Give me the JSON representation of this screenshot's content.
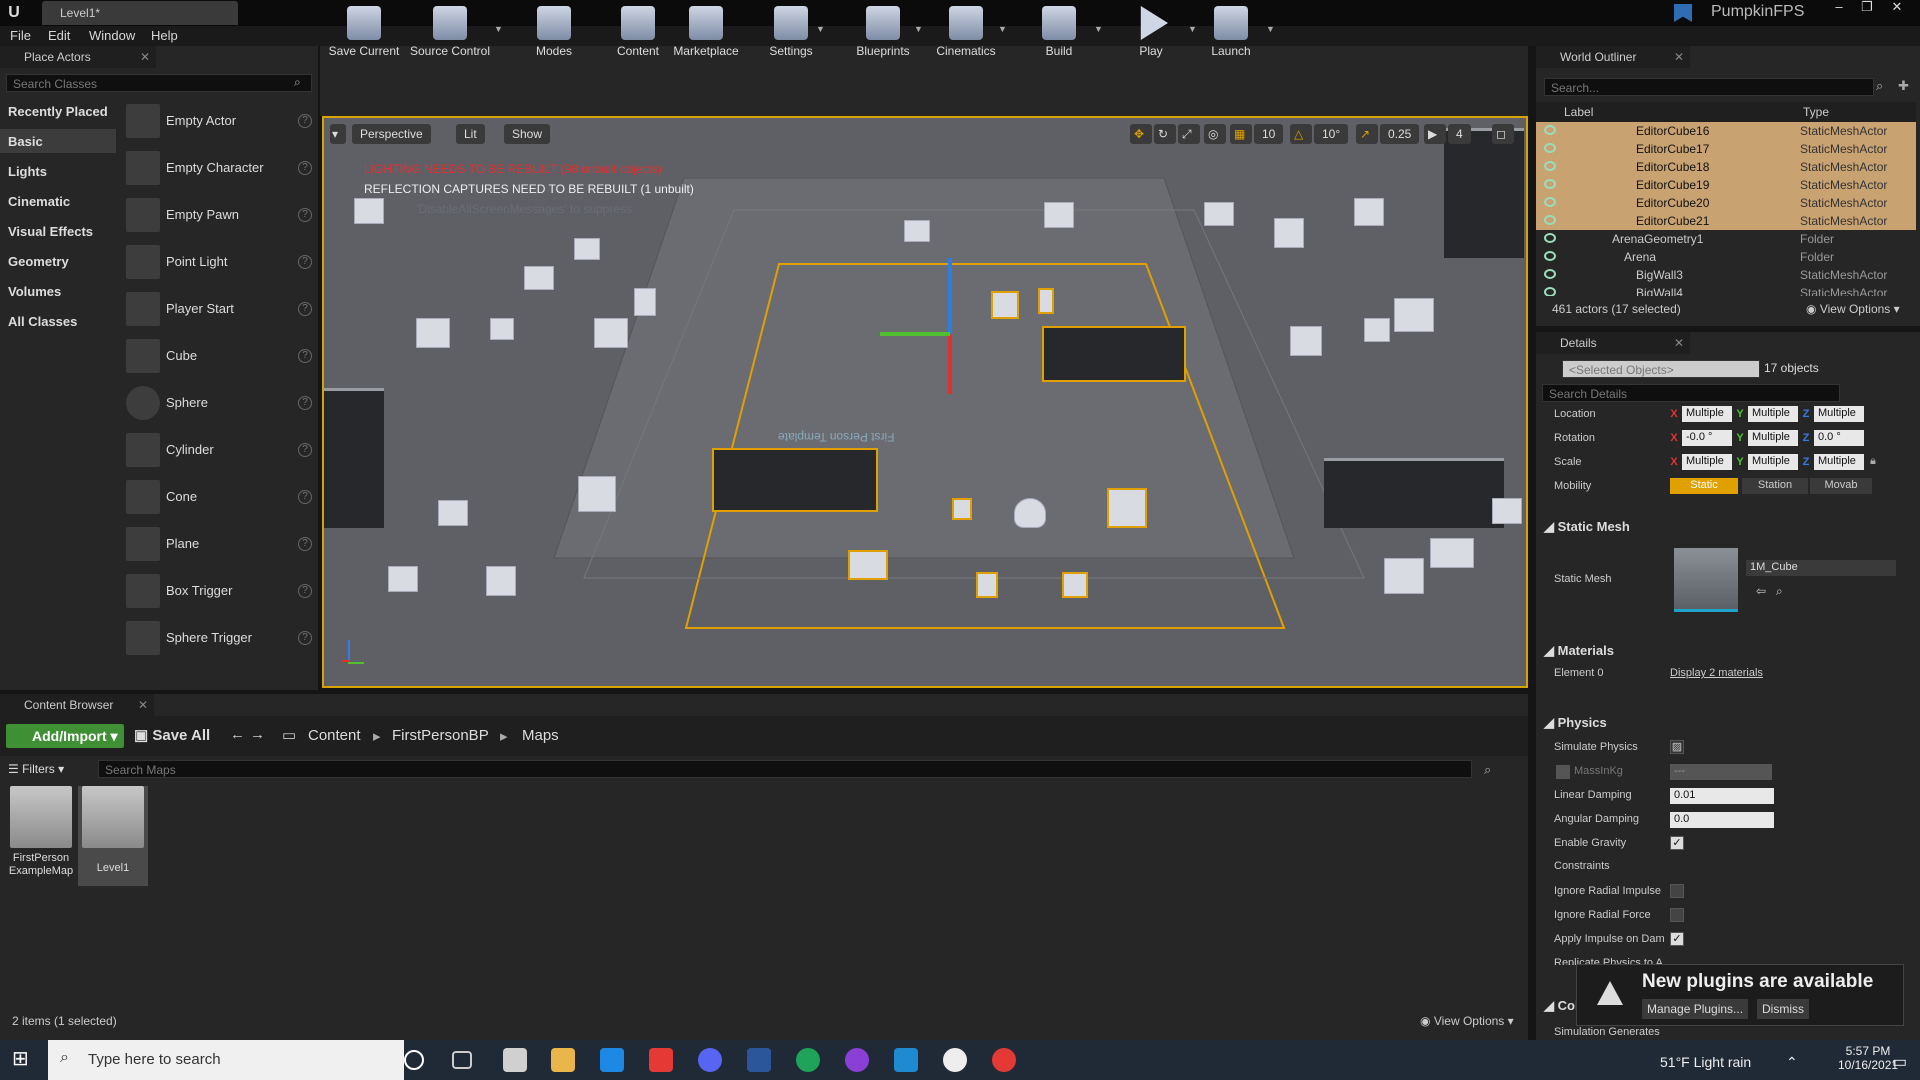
{
  "window": {
    "tab_title": "Level1*",
    "project": "PumpkinFPS",
    "controls": [
      "–",
      "❐",
      "✕"
    ]
  },
  "menu": [
    "File",
    "Edit",
    "Window",
    "Help"
  ],
  "place_actors": {
    "title": "Place Actors",
    "search_placeholder": "Search Classes",
    "categories": [
      "Recently Placed",
      "Basic",
      "Lights",
      "Cinematic",
      "Visual Effects",
      "Geometry",
      "Volumes",
      "All Classes"
    ],
    "selected_category": "Basic",
    "actors": [
      "Empty Actor",
      "Empty Character",
      "Empty Pawn",
      "Point Light",
      "Player Start",
      "Cube",
      "Sphere",
      "Cylinder",
      "Cone",
      "Plane",
      "Box Trigger",
      "Sphere Trigger"
    ]
  },
  "toolbar": [
    "Save Current",
    "Source Control",
    "Modes",
    "Content",
    "Marketplace",
    "Settings",
    "Blueprints",
    "Cinematics",
    "Build",
    "Play",
    "Launch"
  ],
  "viewport": {
    "view_mode": "Perspective",
    "lighting": "Lit",
    "show": "Show",
    "warning_lighting": "LIGHTING NEEDS TO BE REBUILT (98 unbuilt objects)",
    "warning_reflection": "REFLECTION CAPTURES NEED TO BE REBUILT (1 unbuilt)",
    "warning_hint": "'DisableAllScreenMessages' to suppress",
    "grid_snap": "10",
    "rot_snap": "10°",
    "scale_snap": "0.25",
    "camera_speed": "4",
    "floor_text": "First Person Template"
  },
  "content_browser": {
    "title": "Content Browser",
    "add_import": "Add/Import",
    "save_all": "Save All",
    "path": [
      "Content",
      "FirstPersonBP",
      "Maps"
    ],
    "filters": "Filters",
    "search_placeholder": "Search Maps",
    "assets": [
      "FirstPerson ExampleMap",
      "Level1"
    ],
    "status": "2 items (1 selected)",
    "view_options": "View Options"
  },
  "outliner": {
    "title": "World Outliner",
    "search_placeholder": "Search...",
    "col_label": "Label",
    "col_type": "Type",
    "rows": [
      {
        "label": "EditorCube16",
        "type": "StaticMeshActor",
        "selected": true
      },
      {
        "label": "EditorCube17",
        "type": "StaticMeshActor",
        "selected": true
      },
      {
        "label": "EditorCube18",
        "type": "StaticMeshActor",
        "selected": true
      },
      {
        "label": "EditorCube19",
        "type": "StaticMeshActor",
        "selected": true
      },
      {
        "label": "EditorCube20",
        "type": "StaticMeshActor",
        "selected": true
      },
      {
        "label": "EditorCube21",
        "type": "StaticMeshActor",
        "selected": true
      },
      {
        "label": "ArenaGeometry1",
        "type": "Folder",
        "selected": false
      },
      {
        "label": "Arena",
        "type": "Folder",
        "selected": false
      },
      {
        "label": "BigWall3",
        "type": "StaticMeshActor",
        "selected": false
      },
      {
        "label": "BigWall4",
        "type": "StaticMeshActor",
        "selected": false
      }
    ],
    "status": "461 actors (17 selected)",
    "view_options": "View Options"
  },
  "details": {
    "title": "Details",
    "selected_objects": "<Selected Objects>",
    "count": "17 objects",
    "search_placeholder": "Search Details",
    "transform": {
      "location_label": "Location",
      "rotation_label": "Rotation",
      "scale_label": "Scale",
      "mobility_label": "Mobility",
      "location": [
        "Multiple",
        "Multiple",
        "Multiple"
      ],
      "rotation": [
        "-0.0 °",
        "Multiple",
        "0.0 °"
      ],
      "scale": [
        "Multiple",
        "Multiple",
        "Multiple"
      ],
      "mobility": [
        "Static",
        "Station",
        "Movab"
      ]
    },
    "static_mesh_section": "Static Mesh",
    "static_mesh_label": "Static Mesh",
    "static_mesh_value": "1M_Cube",
    "materials_section": "Materials",
    "element0_label": "Element 0",
    "element0_value": "Display 2 materials",
    "physics_section": "Physics",
    "physics": {
      "simulate": "Simulate Physics",
      "mass": "MassInKg",
      "mass_value": "---",
      "linear": "Linear Damping",
      "linear_value": "0.01",
      "angular": "Angular Damping",
      "angular_value": "0.0",
      "gravity": "Enable Gravity",
      "constraints": "Constraints",
      "ignore_impulse": "Ignore Radial Impulse",
      "ignore_force": "Ignore Radial Force",
      "apply_impulse": "Apply Impulse on Dam",
      "replicate": "Replicate Physics to A"
    },
    "collision_section": "Coll",
    "sim_generates": "Simulation Generates"
  },
  "notification": {
    "text": "New plugins are available",
    "manage": "Manage Plugins...",
    "dismiss": "Dismiss"
  },
  "taskbar": {
    "search_placeholder": "Type here to search",
    "weather": "51°F  Light rain",
    "time": "5:57 PM",
    "date": "10/16/2021"
  }
}
